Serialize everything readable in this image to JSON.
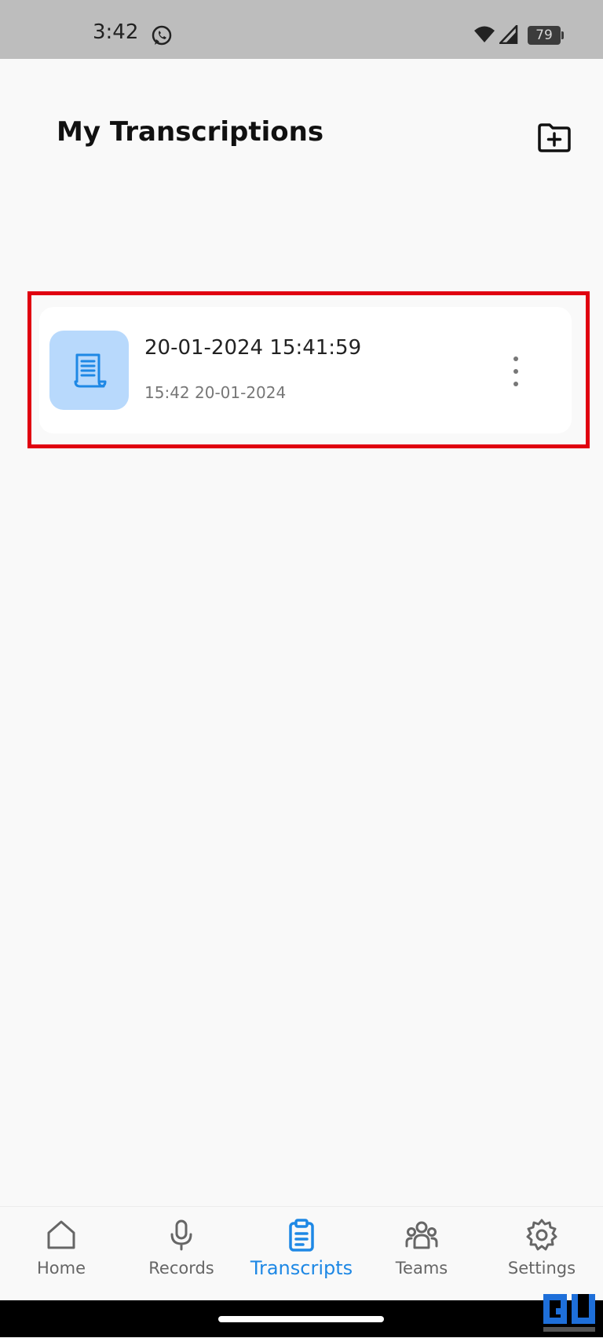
{
  "status_bar": {
    "time": "3:42",
    "battery_level": "79",
    "icons": [
      "whatsapp-icon",
      "wifi-icon",
      "signal-icon",
      "battery-icon"
    ]
  },
  "header": {
    "title": "My Transcriptions",
    "add_folder_icon": "folder-add-icon"
  },
  "transcriptions": [
    {
      "title": "20-01-2024 15:41:59",
      "subtitle": "15:42 20-01-2024",
      "icon": "document-scroll-icon"
    }
  ],
  "bottom_nav": {
    "items": [
      {
        "label": "Home",
        "icon": "home-icon"
      },
      {
        "label": "Records",
        "icon": "microphone-icon"
      },
      {
        "label": "Transcripts",
        "icon": "clipboard-icon",
        "active": true
      },
      {
        "label": "Teams",
        "icon": "team-icon"
      },
      {
        "label": "Settings",
        "icon": "gear-icon"
      }
    ]
  },
  "colors": {
    "accent": "#1e88e5",
    "highlight": "#e00010",
    "thumb_background": "#b8d9fc",
    "status_bar": "#bdbdbd"
  },
  "watermark": "logo-watermark"
}
